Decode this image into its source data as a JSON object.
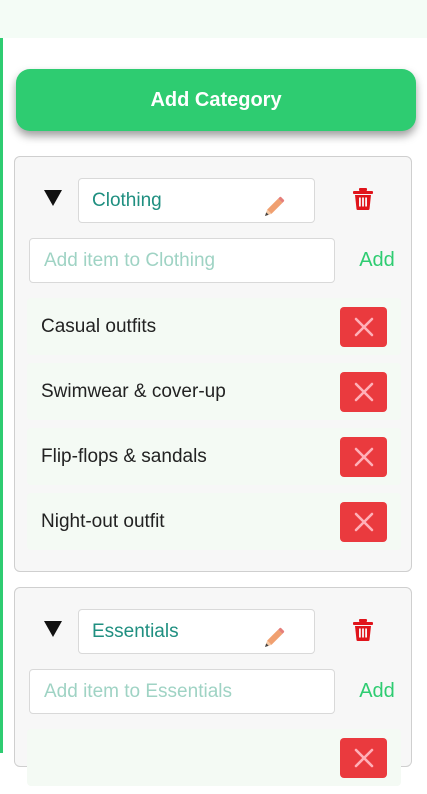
{
  "header": {
    "add_category_label": "Add Category"
  },
  "colors": {
    "accent": "#2ecc71",
    "danger": "#ea3a3e",
    "category_name": "#1f8f80",
    "placeholder": "#9fd3c4"
  },
  "icons": {
    "toggle": "triangle-down-icon",
    "edit": "pencil-icon",
    "delete_category": "trash-icon",
    "remove_item": "close-x-icon"
  },
  "categories": [
    {
      "name": "Clothing",
      "add_placeholder": "Add item to Clothing",
      "add_label": "Add",
      "items": [
        {
          "label": "Casual outfits"
        },
        {
          "label": "Swimwear & cover-up"
        },
        {
          "label": "Flip-flops & sandals"
        },
        {
          "label": "Night-out outfit"
        }
      ]
    },
    {
      "name": "Essentials",
      "add_placeholder": "Add item to Essentials",
      "add_label": "Add",
      "items": []
    }
  ]
}
